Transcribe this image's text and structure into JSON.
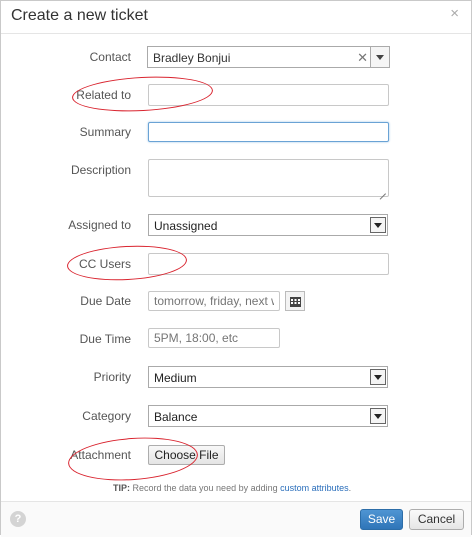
{
  "dialog": {
    "title": "Create a new ticket",
    "close_glyph": "×"
  },
  "form": {
    "contact": {
      "label": "Contact",
      "value": "Bradley Bonjui"
    },
    "related_to": {
      "label": "Related to",
      "value": ""
    },
    "summary": {
      "label": "Summary",
      "value": ""
    },
    "description": {
      "label": "Description",
      "value": ""
    },
    "assigned_to": {
      "label": "Assigned to",
      "value": "Unassigned"
    },
    "cc_users": {
      "label": "CC Users",
      "value": ""
    },
    "due_date": {
      "label": "Due Date",
      "placeholder": "tomorrow, friday, next we"
    },
    "due_time": {
      "label": "Due Time",
      "placeholder": "5PM, 18:00, etc"
    },
    "priority": {
      "label": "Priority",
      "value": "Medium"
    },
    "category": {
      "label": "Category",
      "value": "Balance"
    },
    "attachment": {
      "label": "Attachment",
      "button_label": "Choose File"
    }
  },
  "tip": {
    "prefix": "TIP:",
    "text": " Record the data you need by adding ",
    "link": "custom attributes",
    "suffix": "."
  },
  "footer": {
    "help_glyph": "?",
    "save_label": "Save",
    "cancel_label": "Cancel"
  },
  "colors": {
    "annotation": "#d9232e",
    "primary": "#3a80c1",
    "link": "#2a6ebb"
  }
}
